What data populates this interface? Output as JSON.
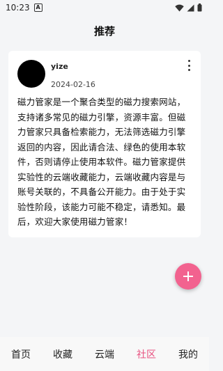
{
  "status_bar": {
    "time": "10:23",
    "badge": "A"
  },
  "header": {
    "title": "推荐"
  },
  "post": {
    "username": "yize",
    "date": "2024-02-16",
    "body": "磁力管家是一个聚合类型的磁力搜索网站，支持诸多常见的磁力引擎，资源丰富。但磁力管家只具备检索能力，无法筛选磁力引擎返回的内容，因此请合法、绿色的使用本软件，否则请停止使用本软件。磁力管家提供实验性的云端收藏能力，云端收藏内容是与账号关联的，不具备公开能力。由于处于实验性阶段，该能力可能不稳定，请悉知。最后，欢迎大家使用磁力管家！"
  },
  "fab": {
    "icon": "plus-icon",
    "color": "#f2628f"
  },
  "bottom_nav": {
    "active_color": "#e8507f",
    "items": [
      {
        "label": "首页"
      },
      {
        "label": "收藏"
      },
      {
        "label": "云端"
      },
      {
        "label": "社区",
        "active": true
      },
      {
        "label": "我的"
      }
    ]
  }
}
